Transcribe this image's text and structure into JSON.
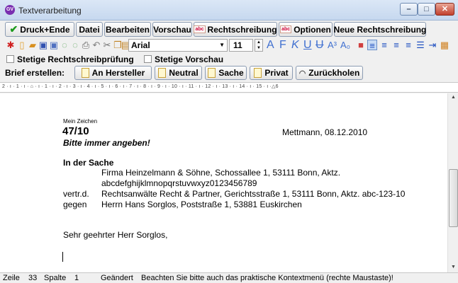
{
  "window": {
    "title": "Textverarbeitung",
    "app_icon": "GV"
  },
  "toolbar": {
    "print_end": "Druck+Ende",
    "file": "Datei",
    "edit": "Bearbeiten",
    "preview": "Vorschau",
    "spelling": "Rechtschreibung",
    "options": "Optionen",
    "new_spelling": "Neue Rechtschreibung"
  },
  "format": {
    "font": "Arial",
    "size": "11"
  },
  "options": {
    "continuous_spelling": "Stetige Rechtschreibprüfung",
    "continuous_preview": "Stetige Vorschau"
  },
  "letter": {
    "label": "Brief erstellen:",
    "to_adversary": "An Hersteller",
    "neutral": "Neutral",
    "matter": "Sache",
    "private": "Privat",
    "retrieve": "Zurückholen"
  },
  "ruler": {
    "text": "2 · ı · 1 · ı · ⌂ · ı · 1 · ı · 2 · ı · 3 · ı · 4 · ı · 5 · ı · 6 · ı · 7 · ı · 8 · ı · 9 · ı · 10 · ı · 11 · ı · 12 · ı · 13 · ı · 14 · ı · 15 · ı ·△6"
  },
  "document": {
    "my_ref_label": "Mein Zeichen",
    "ref_number": "47/10",
    "place_date": "Mettmann, 08.12.2010",
    "ref_note": "Bitte immer angeben!",
    "matter_heading": "In der Sache",
    "party1_line1": "Firma Heinzelmann & Söhne, Schossallee 1, 53111 Bonn, Aktz.",
    "party1_line2": "abcdefghijklmnopqrstuvwxyz0123456789",
    "rep_label": "vertr.d.",
    "rep_text": "Rechtsanwälte Recht & Partner, Gerichtsstraße 1, 53111 Bonn, Aktz. abc-123-10",
    "against_label": "gegen",
    "against_text": "Herrn Hans Sorglos, Poststraße 1, 53881 Euskirchen",
    "salutation": "Sehr geehrter Herr Sorglos,"
  },
  "status": {
    "line_label": "Zeile",
    "line": "33",
    "col_label": "Spalte",
    "col": "1",
    "changed": "Geändert",
    "hint": "Beachten Sie bitte auch das praktische Kontextmenü (rechte Maustaste)!"
  }
}
